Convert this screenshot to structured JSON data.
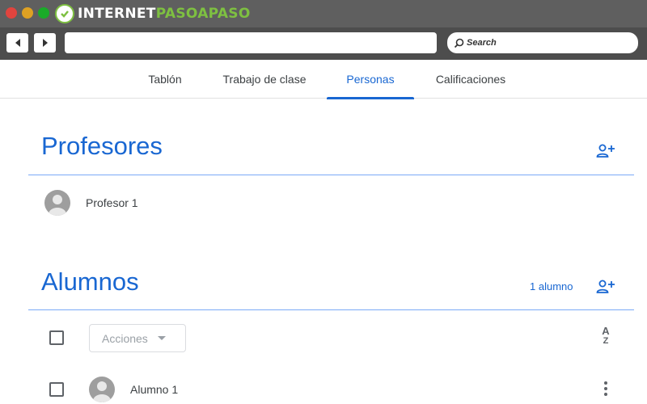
{
  "browser": {
    "logo_text_white": "INTERNET",
    "logo_text_green": "PASOAPASO",
    "search_placeholder": "Search",
    "back_icon": "back-arrow-icon",
    "forward_icon": "forward-arrow-icon"
  },
  "tabs": [
    {
      "label": "Tablón",
      "active": false
    },
    {
      "label": "Trabajo de clase",
      "active": false
    },
    {
      "label": "Personas",
      "active": true
    },
    {
      "label": "Calificaciones",
      "active": false
    }
  ],
  "teachers": {
    "title": "Profesores",
    "add_icon": "person-add-icon",
    "items": [
      {
        "name": "Profesor 1"
      }
    ]
  },
  "students": {
    "title": "Alumnos",
    "count_label": "1 alumno",
    "add_icon": "person-add-icon",
    "actions_label": "Acciones",
    "sort_icon": "sort-az-icon",
    "items": [
      {
        "name": "Alumno 1"
      }
    ]
  },
  "colors": {
    "accent": "#1967d2",
    "divider": "#7baaf7",
    "logo_green": "#7ec041"
  }
}
